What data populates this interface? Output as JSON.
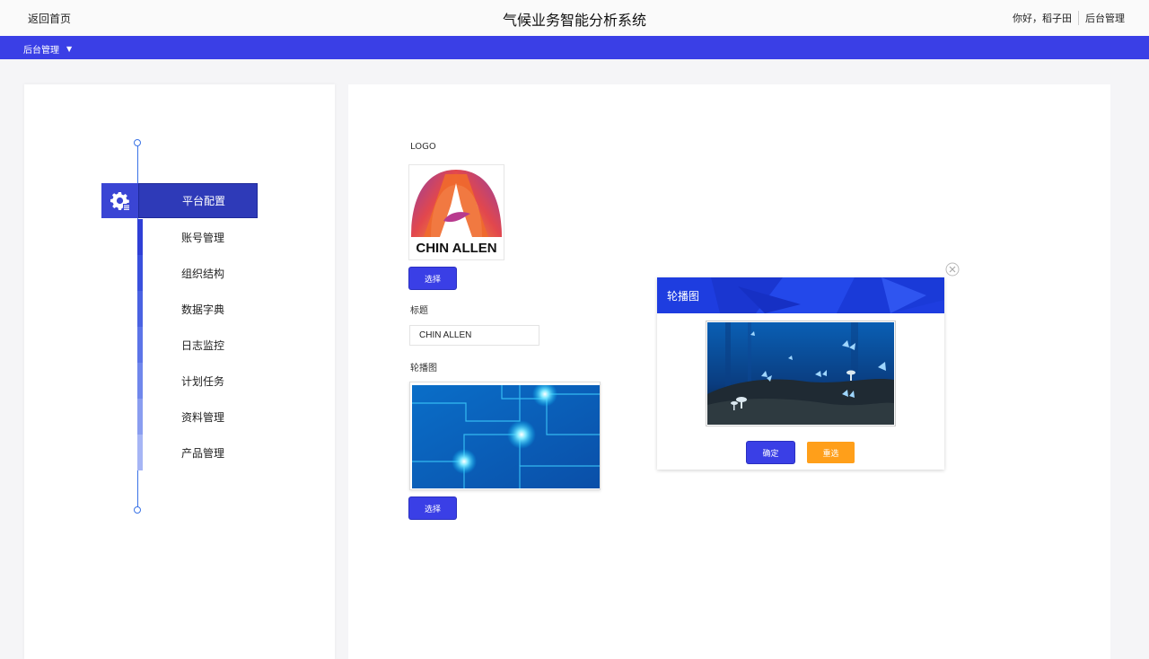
{
  "header": {
    "back_label": "返回首页",
    "app_title": "气候业务智能分析系统",
    "greeting": "你好，稻子田",
    "admin_link": "后台管理"
  },
  "navbar": {
    "menu_label": "后台管理",
    "caret": "▼"
  },
  "sidebar": {
    "items": [
      {
        "label": "平台配置",
        "active": true
      },
      {
        "label": "账号管理"
      },
      {
        "label": "组织结构"
      },
      {
        "label": "数据字典"
      },
      {
        "label": "日志监控"
      },
      {
        "label": "计划任务"
      },
      {
        "label": "资料管理"
      },
      {
        "label": "产品管理"
      }
    ],
    "active_icon": "gear-icon"
  },
  "form": {
    "logo_label": "LOGO",
    "logo_text": "CHIN ALLEN",
    "logo_select_button": "选择",
    "title_label": "标题",
    "title_value": "CHIN ALLEN",
    "banner_label": "轮播图",
    "banner_select_button": "选择"
  },
  "modal": {
    "title": "轮播图",
    "confirm_button": "确定",
    "reselect_button": "重选",
    "close_icon": "close-icon"
  },
  "colors": {
    "primary": "#3a3fe6",
    "active_item": "#2e3ab8",
    "orange": "#ff9f1a",
    "timeline": "#3a73e6"
  }
}
